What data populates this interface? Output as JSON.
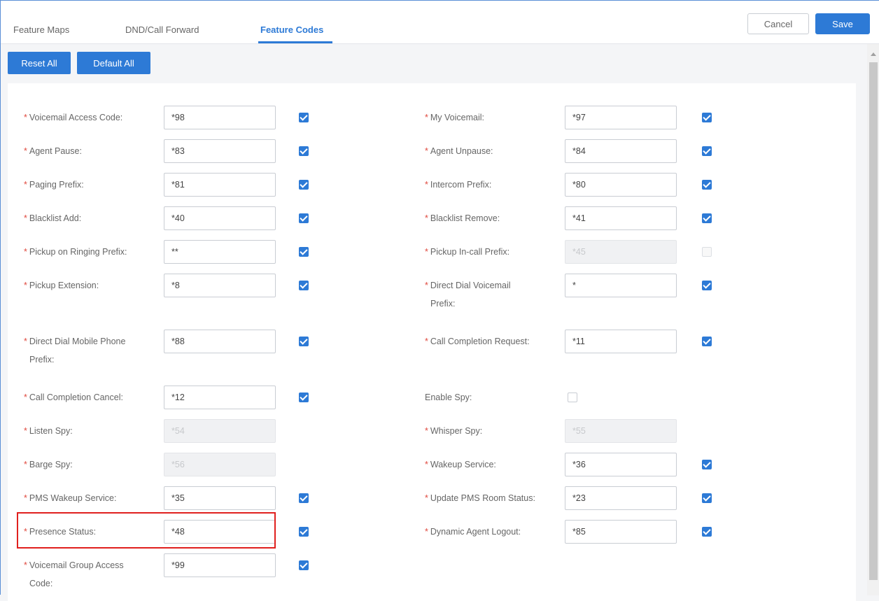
{
  "tabs": {
    "feature_maps": "Feature Maps",
    "dnd_call_forward": "DND/Call Forward",
    "feature_codes": "Feature Codes"
  },
  "header_buttons": {
    "cancel": "Cancel",
    "save": "Save"
  },
  "toolbar": {
    "reset_all": "Reset All",
    "default_all": "Default All"
  },
  "left": [
    {
      "label": "Voicemail Access Code:",
      "label2": "",
      "value": "*98",
      "checked": true,
      "disabled": false
    },
    {
      "label": "Agent Pause:",
      "label2": "",
      "value": "*83",
      "checked": true,
      "disabled": false
    },
    {
      "label": "Paging Prefix:",
      "label2": "",
      "value": "*81",
      "checked": true,
      "disabled": false
    },
    {
      "label": "Blacklist Add:",
      "label2": "",
      "value": "*40",
      "checked": true,
      "disabled": false
    },
    {
      "label": "Pickup on Ringing Prefix:",
      "label2": "",
      "value": "**",
      "checked": true,
      "disabled": false
    },
    {
      "label": "Pickup Extension:",
      "label2": "",
      "value": "*8",
      "checked": true,
      "disabled": false
    },
    {
      "label": "Direct Dial Mobile Phone",
      "label2": "Prefix:",
      "value": "*88",
      "checked": true,
      "disabled": false
    },
    {
      "label": "Call Completion Cancel:",
      "label2": "",
      "value": "*12",
      "checked": true,
      "disabled": false
    },
    {
      "label": "Listen Spy:",
      "label2": "",
      "value": "*54",
      "checked": null,
      "disabled": true
    },
    {
      "label": "Barge Spy:",
      "label2": "",
      "value": "*56",
      "checked": null,
      "disabled": true
    },
    {
      "label": "PMS Wakeup Service:",
      "label2": "",
      "value": "*35",
      "checked": true,
      "disabled": false
    },
    {
      "label": "Presence Status:",
      "label2": "",
      "value": "*48",
      "checked": true,
      "disabled": false
    },
    {
      "label": "Voicemail Group Access",
      "label2": "Code:",
      "value": "*99",
      "checked": true,
      "disabled": false
    }
  ],
  "right": [
    {
      "label": "My Voicemail:",
      "label2": "",
      "value": "*97",
      "checked": true,
      "disabled": false,
      "required": true
    },
    {
      "label": "Agent Unpause:",
      "label2": "",
      "value": "*84",
      "checked": true,
      "disabled": false,
      "required": true
    },
    {
      "label": "Intercom Prefix:",
      "label2": "",
      "value": "*80",
      "checked": true,
      "disabled": false,
      "required": true
    },
    {
      "label": "Blacklist Remove:",
      "label2": "",
      "value": "*41",
      "checked": true,
      "disabled": false,
      "required": true
    },
    {
      "label": "Pickup In-call Prefix:",
      "label2": "",
      "value": "*45",
      "checked": false,
      "disabled": true,
      "required": true
    },
    {
      "label": "Direct Dial Voicemail",
      "label2": "Prefix:",
      "value": "*",
      "checked": true,
      "disabled": false,
      "required": true
    },
    {
      "label": "Call Completion Request:",
      "label2": "",
      "value": "*11",
      "checked": true,
      "disabled": false,
      "required": true
    },
    {
      "label": "Enable Spy:",
      "label2": "",
      "value": null,
      "checked": false,
      "disabled": false,
      "required": false
    },
    {
      "label": "Whisper Spy:",
      "label2": "",
      "value": "*55",
      "checked": null,
      "disabled": true,
      "required": true
    },
    {
      "label": "Wakeup Service:",
      "label2": "",
      "value": "*36",
      "checked": true,
      "disabled": false,
      "required": true
    },
    {
      "label": "Update PMS Room Status:",
      "label2": "",
      "value": "*23",
      "checked": true,
      "disabled": false,
      "required": true
    },
    {
      "label": "Dynamic Agent Logout:",
      "label2": "",
      "value": "*85",
      "checked": true,
      "disabled": false,
      "required": true
    }
  ],
  "colors": {
    "accent": "#2d7ad6",
    "required": "#e04a3f",
    "highlight": "#e0201e"
  }
}
